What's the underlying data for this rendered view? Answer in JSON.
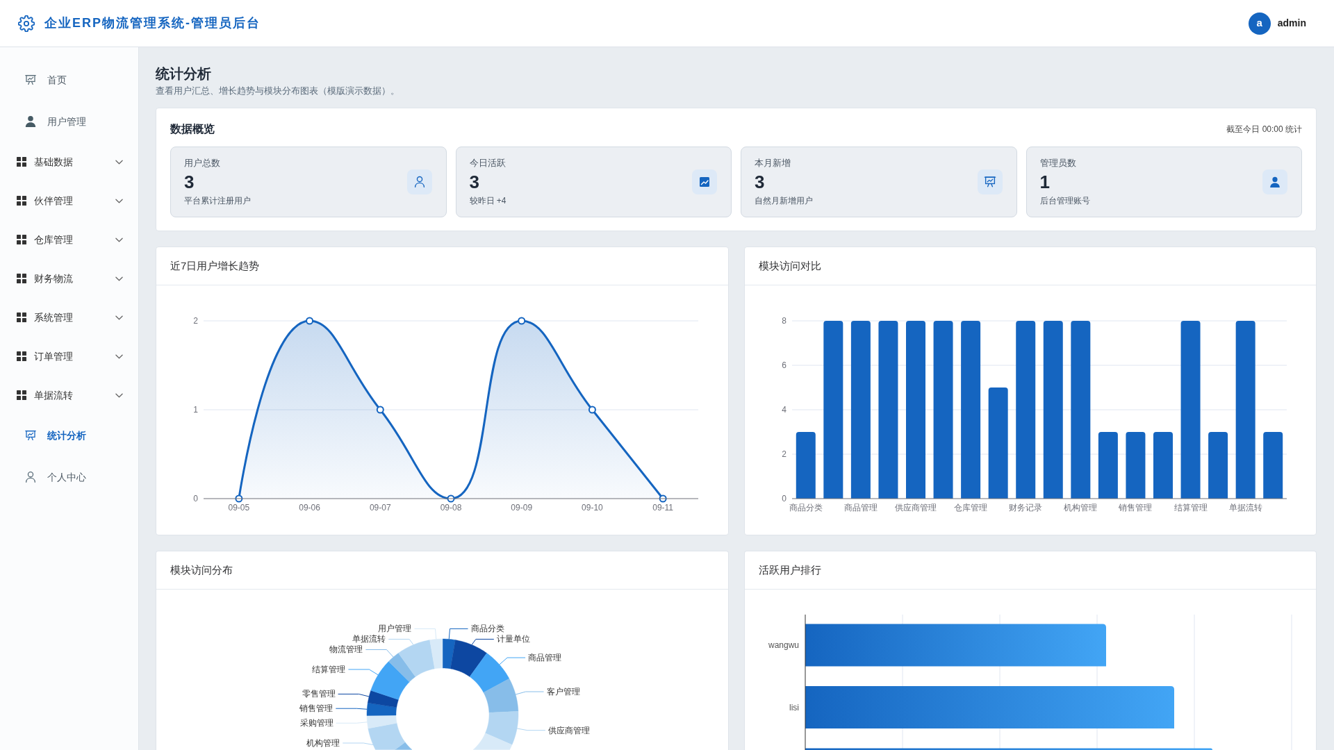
{
  "header": {
    "title": "企业ERP物流管理系统-管理员后台",
    "avatar": "a",
    "user": "admin"
  },
  "sidebar": {
    "items": [
      {
        "label": "首页",
        "kind": "board",
        "selected": false
      },
      {
        "label": "用户管理",
        "kind": "user",
        "selected": false
      },
      {
        "label": "基础数据",
        "kind": "group",
        "expanded": false,
        "selected": false
      },
      {
        "label": "伙伴管理",
        "kind": "group",
        "expanded": false,
        "selected": false
      },
      {
        "label": "仓库管理",
        "kind": "group",
        "expanded": false,
        "selected": false
      },
      {
        "label": "财务物流",
        "kind": "group",
        "expanded": false,
        "selected": false
      },
      {
        "label": "系统管理",
        "kind": "group",
        "expanded": false,
        "selected": false
      },
      {
        "label": "订单管理",
        "kind": "group",
        "expanded": false,
        "selected": false
      },
      {
        "label": "单据流转",
        "kind": "group",
        "expanded": false,
        "selected": false
      },
      {
        "label": "统计分析",
        "kind": "board",
        "selected": true
      },
      {
        "label": "个人中心",
        "kind": "profile",
        "selected": false
      }
    ]
  },
  "page": {
    "title": "统计分析",
    "subtitle": "查看用户汇总、增长趋势与模块分布图表（模版演示数据）。"
  },
  "overview": {
    "title": "数据概览",
    "timestamp": "截至今日 00:00 统计",
    "stats": [
      {
        "label": "用户总数",
        "value": "3",
        "note": "平台累计注册用户",
        "kind": "users"
      },
      {
        "label": "今日活跃",
        "value": "3",
        "note": "较昨日 +4",
        "kind": "trend"
      },
      {
        "label": "本月新增",
        "value": "3",
        "note": "自然月新增用户",
        "kind": "board"
      },
      {
        "label": "管理员数",
        "value": "1",
        "note": "后台管理账号",
        "kind": "admin"
      }
    ]
  },
  "growth_chart": {
    "chart_data": {
      "type": "area",
      "title": "近7日用户增长趋势",
      "categories": [
        "09-05",
        "09-06",
        "09-07",
        "09-08",
        "09-09",
        "09-10",
        "09-11"
      ],
      "series": [
        {
          "color": "#1565c0",
          "values": [
            0,
            2,
            1,
            0,
            2,
            1,
            0
          ]
        }
      ],
      "ylim": [
        0,
        2
      ],
      "yticks": [
        0,
        1,
        2
      ],
      "grid": true
    }
  },
  "module_chart": {
    "chart_data": {
      "type": "bar",
      "title": "模块访问对比",
      "categories": [
        "商品分类",
        null,
        "商品管理",
        null,
        "供应商管理",
        null,
        "仓库管理",
        null,
        "财务记录",
        null,
        "机构管理",
        null,
        "销售管理",
        null,
        "结算管理",
        null,
        "单据流转",
        null
      ],
      "series": [
        {
          "color": "#1565c0",
          "values": [
            3,
            8,
            8,
            8,
            8,
            8,
            8,
            5,
            8,
            8,
            8,
            3,
            3,
            3,
            8,
            3,
            8,
            3
          ]
        }
      ],
      "ylim": [
        0,
        8
      ],
      "yticks": [
        0,
        2,
        4,
        6,
        8
      ],
      "grid": true
    }
  },
  "distribution_chart": {
    "title": "模块访问分布",
    "left_labels": [
      "用户管理",
      "单据流转",
      "物流管理",
      "结算管理",
      "零售管理",
      "销售管理",
      "采购管理",
      "机构管理"
    ],
    "right_labels": [
      "商品分类",
      "计量单位",
      "商品管理",
      "客户管理",
      "供应商管理"
    ]
  },
  "ranking": {
    "title": "活跃用户排行",
    "users": [
      "wangwu",
      "lisi"
    ]
  }
}
